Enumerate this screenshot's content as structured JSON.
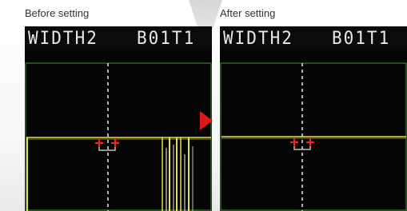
{
  "colors": {
    "accent_arrow": "#e0161a",
    "trace_yellow": "#e6e04a",
    "marker_red": "#ff2020",
    "grid_green": "#3f7d35"
  },
  "panels": [
    {
      "caption": "Before setting",
      "label_left": "WIDTH2",
      "label_right": "B01T1"
    },
    {
      "caption": "After setting",
      "label_left": "WIDTH2",
      "label_right": "B01T1"
    }
  ]
}
